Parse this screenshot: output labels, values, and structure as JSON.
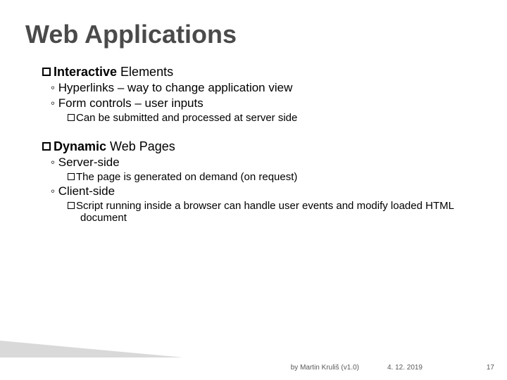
{
  "title": "Web Applications",
  "sections": [
    {
      "head_bold": "Interactive",
      "head_rest": " Elements",
      "items": [
        {
          "text": "Hyperlinks – way to change application view"
        },
        {
          "text": "Form controls – user inputs",
          "sub": [
            "Can be submitted and processed at server side"
          ]
        }
      ]
    },
    {
      "head_bold": "Dynamic",
      "head_rest": " Web Pages",
      "items": [
        {
          "text": "Server-side",
          "sub": [
            "The page is generated on demand (on request)"
          ]
        },
        {
          "text": "Client-side",
          "sub": [
            "Script running inside a browser can handle user events and modify loaded HTML document"
          ]
        }
      ]
    }
  ],
  "footer": {
    "byline": "by Martin Kruliš (v1.0)",
    "date": "4. 12. 2019",
    "page": "17"
  }
}
